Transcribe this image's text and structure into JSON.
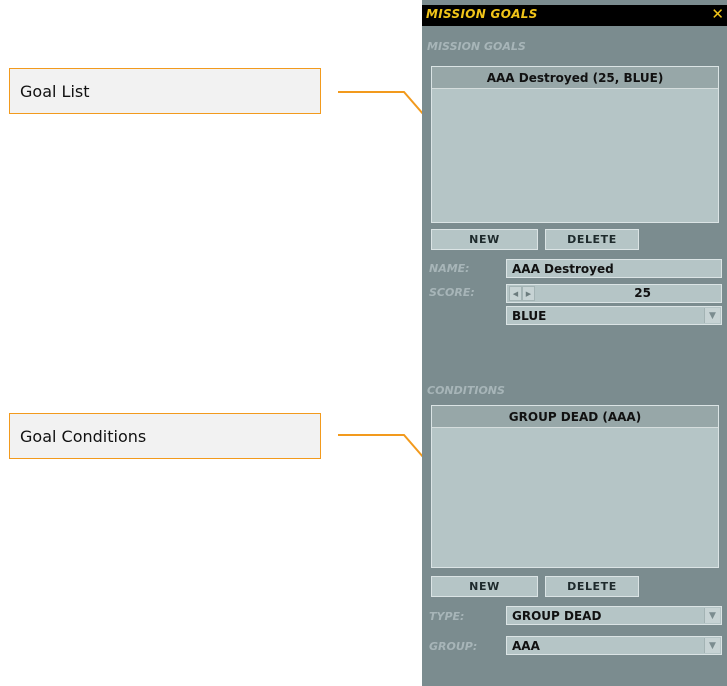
{
  "callouts": [
    {
      "label": "Goal List"
    },
    {
      "label": "Goal Conditions"
    }
  ],
  "window": {
    "title": "MISSION GOALS",
    "close_glyph": "✕"
  },
  "goals": {
    "section_label": "MISSION GOALS",
    "items": [
      "AAA Destroyed (25, BLUE)"
    ],
    "new_label": "NEW",
    "delete_label": "DELETE"
  },
  "goal_form": {
    "name_label": "NAME:",
    "name_value": "AAA Destroyed",
    "score_label": "SCORE:",
    "score_value": "25",
    "coalition_value": "BLUE"
  },
  "conditions": {
    "section_label": "CONDITIONS",
    "items": [
      "GROUP DEAD (AAA)"
    ],
    "new_label": "NEW",
    "delete_label": "DELETE",
    "type_label": "TYPE:",
    "type_value": "GROUP DEAD",
    "group_label": "GROUP:",
    "group_value": "AAA"
  },
  "colors": {
    "panel": "#7b8c8f",
    "title_text": "#f0c419",
    "callout_border": "#f29a1d",
    "list_bg": "#b5c5c6"
  },
  "icons": {
    "close": "close-icon",
    "dropdown": "chevron-down-icon",
    "spinner": "spinner-arrows-icon"
  }
}
